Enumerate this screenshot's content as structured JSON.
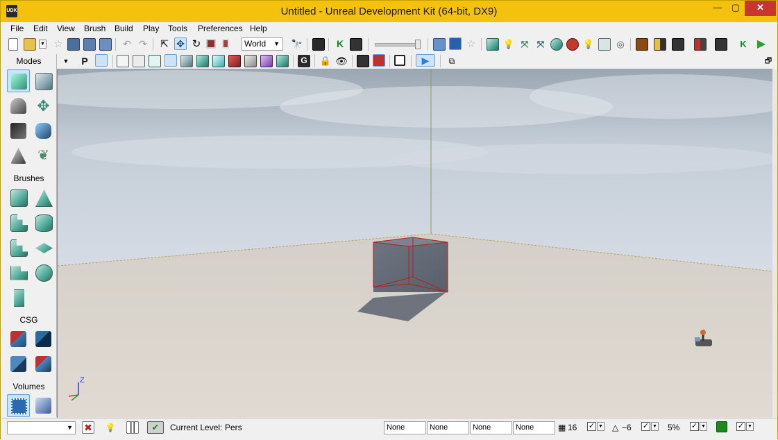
{
  "window": {
    "title": "Untitled - Unreal Development Kit (64-bit, DX9)",
    "app_icon_text": "UDK",
    "min_glyph": "—",
    "max_glyph": "▢",
    "close_glyph": "✕"
  },
  "menu": [
    "File",
    "Edit",
    "View",
    "Brush",
    "Build",
    "Play",
    "Tools",
    "Preferences",
    "Help"
  ],
  "toolbar": {
    "coordinate_system": "World",
    "viewport_restore_glyph": "🗗"
  },
  "left_panel": {
    "modes_label": "Modes",
    "brushes_label": "Brushes",
    "csg_label": "CSG",
    "volumes_label": "Volumes"
  },
  "viewport": {
    "axis_z": "Z"
  },
  "statusbar": {
    "current_level_label": "Current Level:",
    "current_level_value": "Pers",
    "fields": [
      "None",
      "None",
      "None",
      "None"
    ],
    "grid_size": "16",
    "rotation_snap": "~6",
    "scale_snap": "5%"
  },
  "colors": {
    "titlebar": "#f4c20d",
    "close_button": "#c7372f",
    "accent": "#2c7fd6"
  }
}
